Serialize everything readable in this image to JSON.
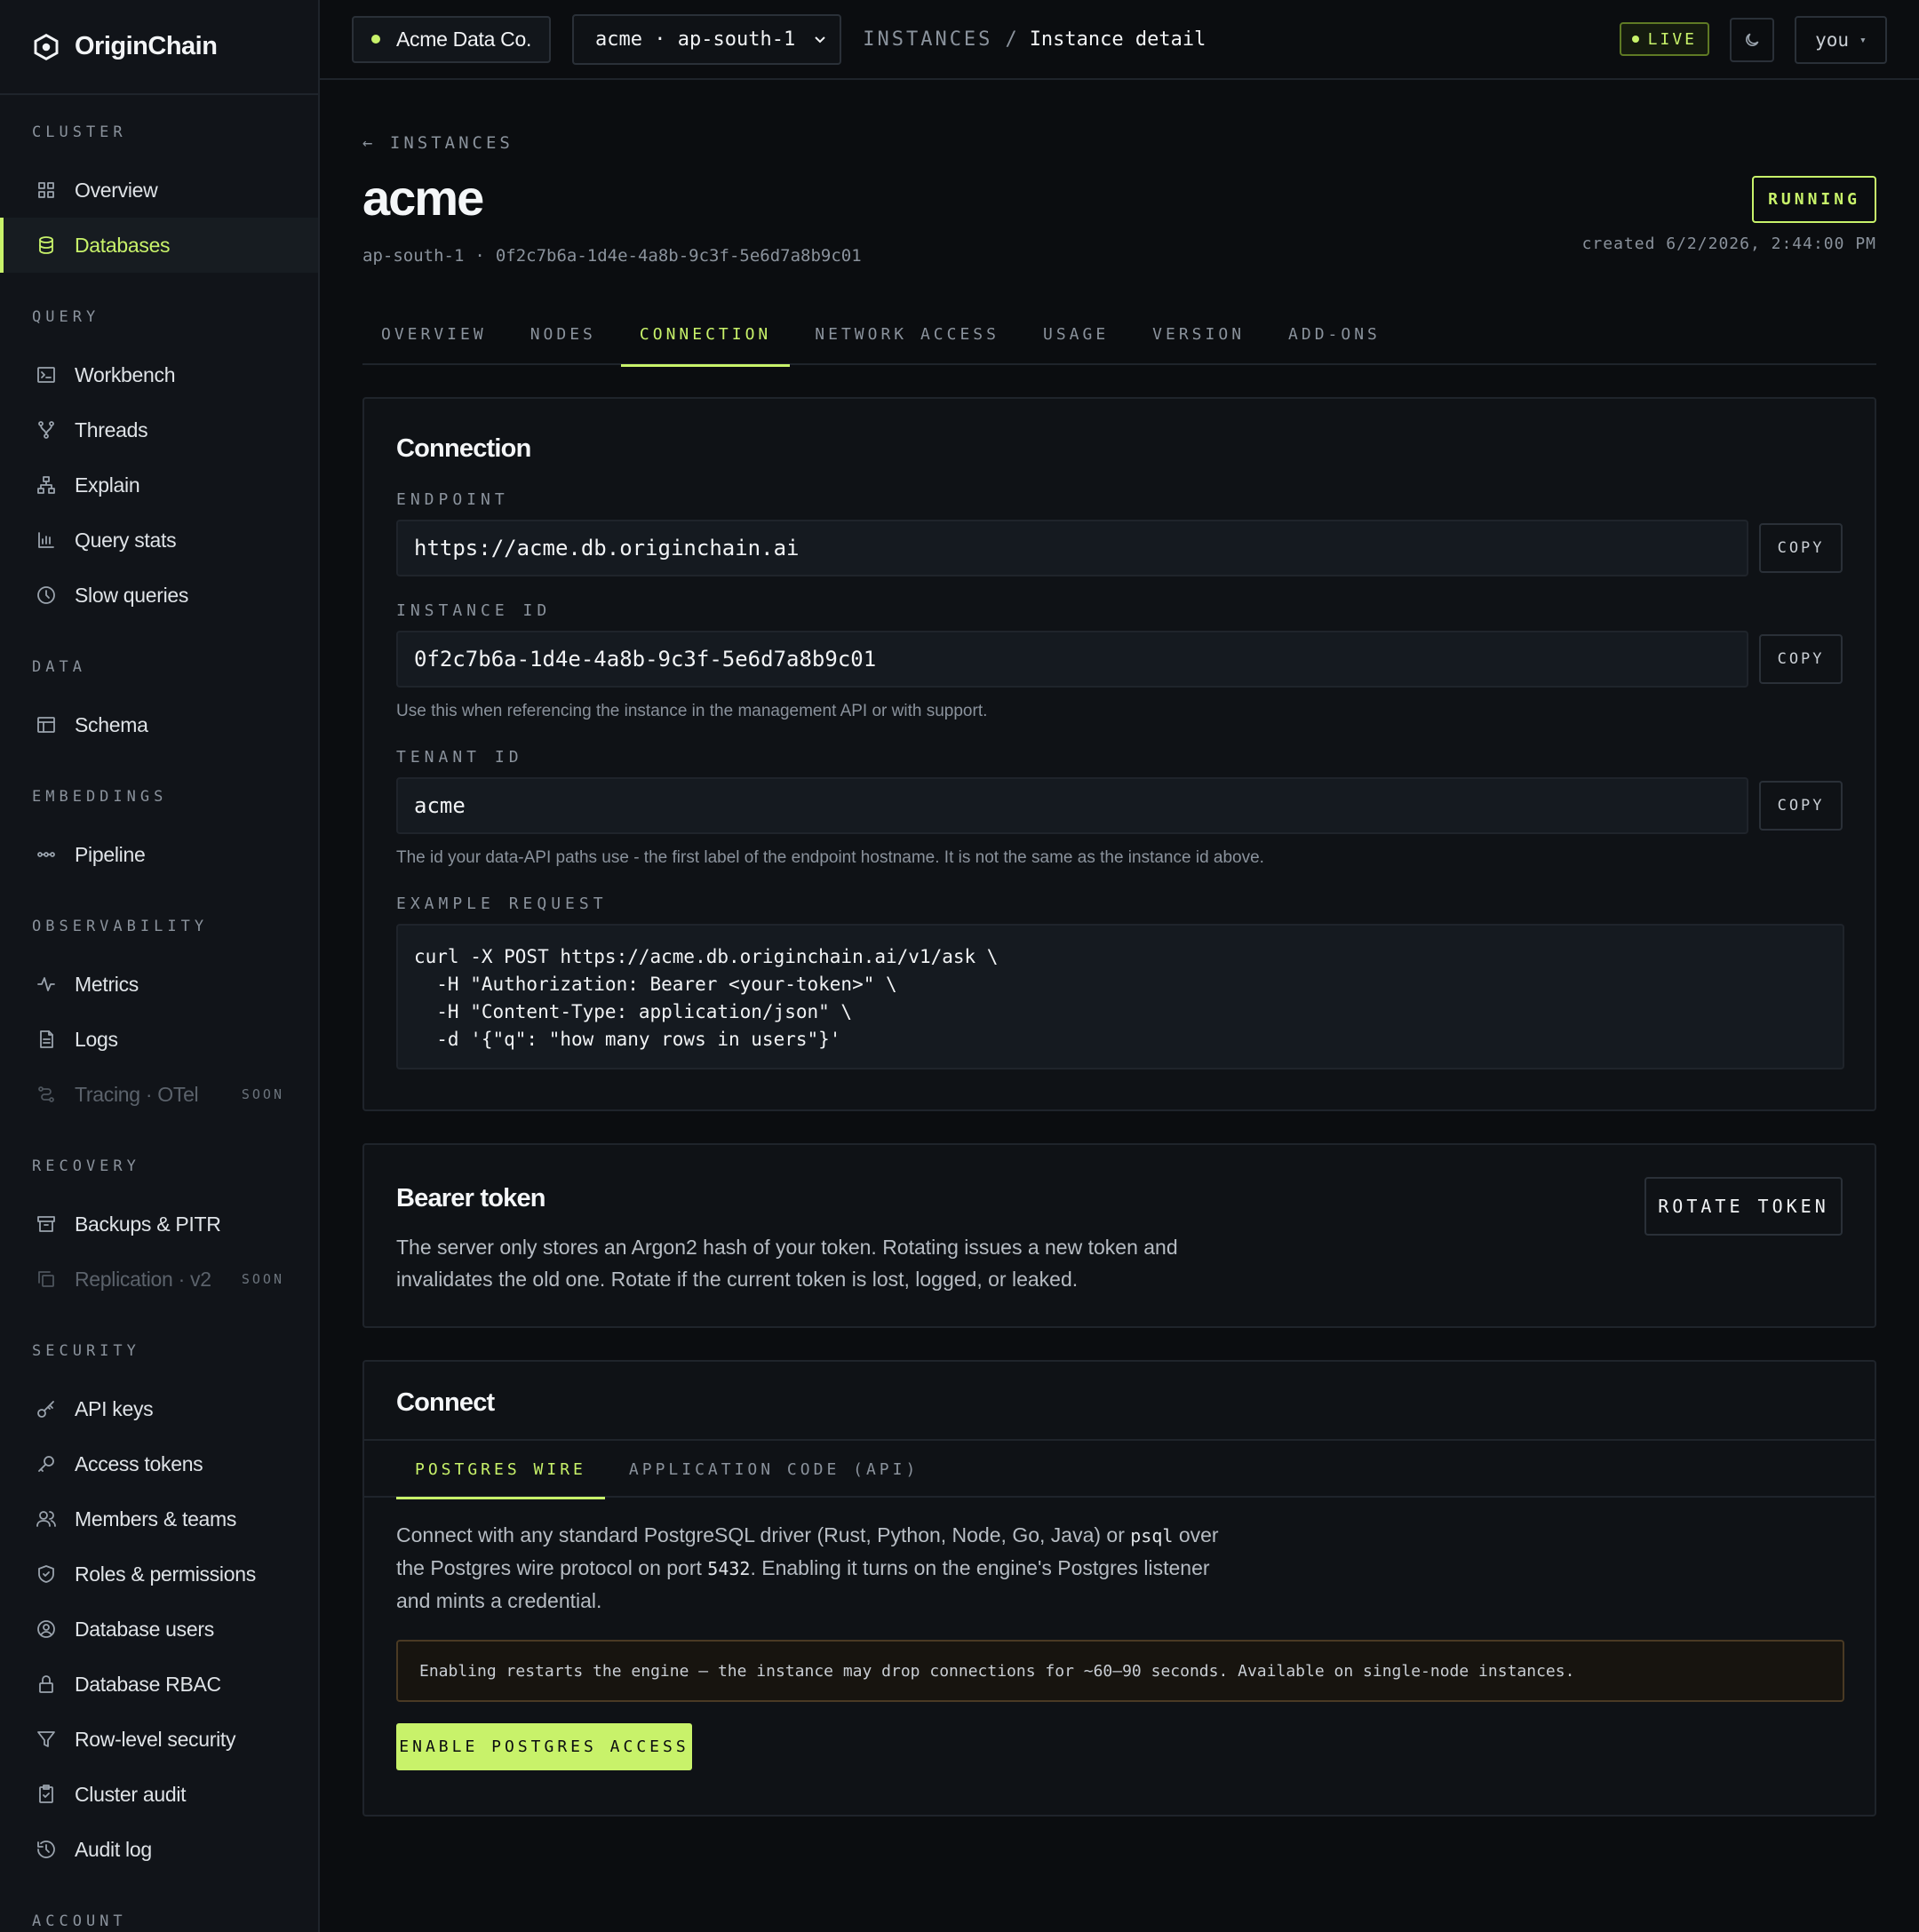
{
  "brand": {
    "name": "OriginChain",
    "logo_icon": "hexagon-logo-icon"
  },
  "sidebar": {
    "sections": [
      {
        "heading": "CLUSTER",
        "items": [
          {
            "label": "Overview",
            "icon": "grid-icon"
          },
          {
            "label": "Databases",
            "icon": "database-icon",
            "active": true
          }
        ]
      },
      {
        "heading": "QUERY",
        "items": [
          {
            "label": "Workbench",
            "icon": "terminal-icon"
          },
          {
            "label": "Threads",
            "icon": "branch-icon"
          },
          {
            "label": "Explain",
            "icon": "tree-icon"
          },
          {
            "label": "Query stats",
            "icon": "bar-chart-icon"
          },
          {
            "label": "Slow queries",
            "icon": "clock-icon"
          }
        ]
      },
      {
        "heading": "DATA",
        "items": [
          {
            "label": "Schema",
            "icon": "table-icon"
          }
        ]
      },
      {
        "heading": "EMBEDDINGS",
        "items": [
          {
            "label": "Pipeline",
            "icon": "pipeline-icon"
          }
        ]
      },
      {
        "heading": "OBSERVABILITY",
        "items": [
          {
            "label": "Metrics",
            "icon": "pulse-icon"
          },
          {
            "label": "Logs",
            "icon": "file-icon"
          },
          {
            "label": "Tracing · OTel",
            "icon": "trace-icon",
            "disabled": true,
            "badge": "SOON"
          }
        ]
      },
      {
        "heading": "RECOVERY",
        "items": [
          {
            "label": "Backups & PITR",
            "icon": "archive-icon"
          },
          {
            "label": "Replication · v2",
            "icon": "copy-icon",
            "disabled": true,
            "badge": "SOON"
          }
        ]
      },
      {
        "heading": "SECURITY",
        "items": [
          {
            "label": "API keys",
            "icon": "key-icon"
          },
          {
            "label": "Access tokens",
            "icon": "token-key-icon"
          },
          {
            "label": "Members & teams",
            "icon": "users-icon"
          },
          {
            "label": "Roles & permissions",
            "icon": "shield-icon"
          },
          {
            "label": "Database users",
            "icon": "user-circle-icon"
          },
          {
            "label": "Database RBAC",
            "icon": "lock-icon"
          },
          {
            "label": "Row-level security",
            "icon": "filter-icon"
          },
          {
            "label": "Cluster audit",
            "icon": "clipboard-icon"
          },
          {
            "label": "Audit log",
            "icon": "history-icon"
          }
        ]
      },
      {
        "heading": "ACCOUNT",
        "items": []
      }
    ]
  },
  "topbar": {
    "org": "Acme Data Co.",
    "instance_select": "acme · ap-south-1",
    "breadcrumb_root": "INSTANCES",
    "breadcrumb_sep": "/",
    "breadcrumb_current": "Instance detail",
    "live": "LIVE",
    "user": "you",
    "user_caret": "▾"
  },
  "page": {
    "back": "← INSTANCES",
    "title": "acme",
    "region": "ap-south-1",
    "sep": "·",
    "instance_id": "0f2c7b6a-1d4e-4a8b-9c3f-5e6d7a8b9c01",
    "status": "RUNNING",
    "created": "created 6/2/2026, 2:44:00 PM",
    "tabs": [
      "OVERVIEW",
      "NODES",
      "CONNECTION",
      "NETWORK ACCESS",
      "USAGE",
      "VERSION",
      "ADD-ONS"
    ],
    "active_tab": "CONNECTION"
  },
  "connection": {
    "title": "Connection",
    "endpoint_label": "ENDPOINT",
    "endpoint_value": "https://acme.db.originchain.ai",
    "instance_id_label": "INSTANCE ID",
    "instance_id_value": "0f2c7b6a-1d4e-4a8b-9c3f-5e6d7a8b9c01",
    "instance_id_help": "Use this when referencing the instance in the management API or with support.",
    "tenant_id_label": "TENANT ID",
    "tenant_id_value": "acme",
    "tenant_id_help": "The id your data-API paths use - the first label of the endpoint hostname. It is not the same as the instance id above.",
    "example_label": "EXAMPLE REQUEST",
    "example_code": "curl -X POST https://acme.db.originchain.ai/v1/ask \\\n  -H \"Authorization: Bearer <your-token>\" \\\n  -H \"Content-Type: application/json\" \\\n  -d '{\"q\": \"how many rows in users\"}'",
    "copy_label": "COPY"
  },
  "bearer": {
    "title": "Bearer token",
    "text": "The server only stores an Argon2 hash of your token. Rotating issues a new token and invalidates the old one. Rotate if the current token is lost, logged, or leaked.",
    "rotate_label": "ROTATE TOKEN"
  },
  "connect": {
    "title": "Connect",
    "tabs": [
      "POSTGRES WIRE",
      "APPLICATION CODE (API)"
    ],
    "active_tab": "POSTGRES WIRE",
    "text_part1": "Connect with any standard PostgreSQL driver (Rust, Python, Node, Go, Java) or ",
    "text_code": "psql",
    "text_part2": " over the Postgres wire protocol on port ",
    "text_port": "5432",
    "text_part3": ". Enabling it turns on the engine's Postgres listener and mints a credential.",
    "warning": "Enabling restarts the engine — the instance may drop connections for ~60–90 seconds. Available on single-node instances.",
    "enable_label": "ENABLE POSTGRES ACCESS"
  },
  "colors": {
    "accent": "#c8f26a",
    "background": "#0b0d10",
    "panel": "#0f1216",
    "warning_border": "#4a3a24"
  }
}
